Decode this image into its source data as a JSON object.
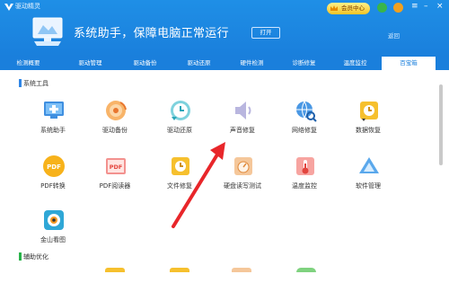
{
  "app": {
    "title": "驱动精灵"
  },
  "top_bar": {
    "promo_label": "会员中心"
  },
  "hero": {
    "headline": "系统助手，保障电脑正常运行",
    "open_button": "打开",
    "back_link": "返回"
  },
  "tabs": [
    {
      "label": "检测概要"
    },
    {
      "label": "驱动管理"
    },
    {
      "label": "驱动备份"
    },
    {
      "label": "驱动还原"
    },
    {
      "label": "硬件检测"
    },
    {
      "label": "诊断修复"
    },
    {
      "label": "温度监控"
    },
    {
      "label": "百宝箱"
    }
  ],
  "sections": {
    "system_tools": {
      "title": "系统工具"
    },
    "assist": {
      "title": "辅助优化"
    }
  },
  "tools_row1": [
    {
      "label": "系统助手",
      "icon": "monitor-plus-icon"
    },
    {
      "label": "驱动备份",
      "icon": "backup-disc-icon"
    },
    {
      "label": "驱动还原",
      "icon": "restore-clock-icon"
    },
    {
      "label": "声音修复",
      "icon": "speaker-icon"
    },
    {
      "label": "网络修复",
      "icon": "globe-search-icon"
    },
    {
      "label": "数据恢复",
      "icon": "data-recovery-icon"
    }
  ],
  "tools_row2": [
    {
      "label": "PDF转换",
      "icon": "pdf-convert-icon"
    },
    {
      "label": "PDF阅读器",
      "icon": "pdf-reader-icon"
    },
    {
      "label": "文件修复",
      "icon": "file-repair-icon"
    },
    {
      "label": "硬盘读写测试",
      "icon": "disk-speed-icon"
    },
    {
      "label": "温度监控",
      "icon": "thermometer-icon"
    },
    {
      "label": "软件管理",
      "icon": "software-manager-icon"
    }
  ],
  "tools_row3": [
    {
      "label": "金山看图",
      "icon": "image-viewer-icon"
    }
  ],
  "colors": {
    "header": "#1a7fdc",
    "accent": "#2f86e6",
    "arrow": "#e8262a"
  }
}
